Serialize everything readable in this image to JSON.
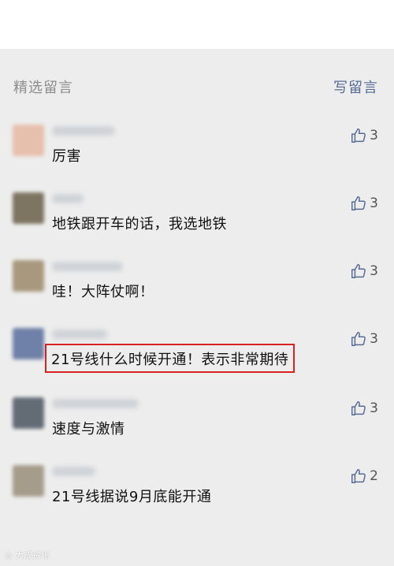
{
  "header": {
    "title": "精选留言",
    "write_label": "写留言"
  },
  "comments": [
    {
      "text": "厉害",
      "likes": "3",
      "highlighted": false,
      "avatar_color": "#d9a28f"
    },
    {
      "text": "地铁跟开车的话，我选地铁",
      "likes": "3",
      "highlighted": false,
      "avatar_color": "#6b5f4a"
    },
    {
      "text": "哇！大阵仗啊！",
      "likes": "3",
      "highlighted": false,
      "avatar_color": "#8a7b61"
    },
    {
      "text": "21号线什么时候开通！表示非常期待",
      "likes": "3",
      "highlighted": true,
      "avatar_color": "#5a6f9c"
    },
    {
      "text": "速度与激情",
      "likes": "3",
      "highlighted": false,
      "avatar_color": "#4c5561"
    },
    {
      "text": "21号线据说9月底能开通",
      "likes": "2",
      "highlighted": false,
      "avatar_color": "#9a8e7a"
    }
  ],
  "icons": {
    "like": "thumbs-up-icon"
  },
  "colors": {
    "link": "#576b95",
    "highlight_border": "#d82323",
    "background": "#ededed"
  }
}
